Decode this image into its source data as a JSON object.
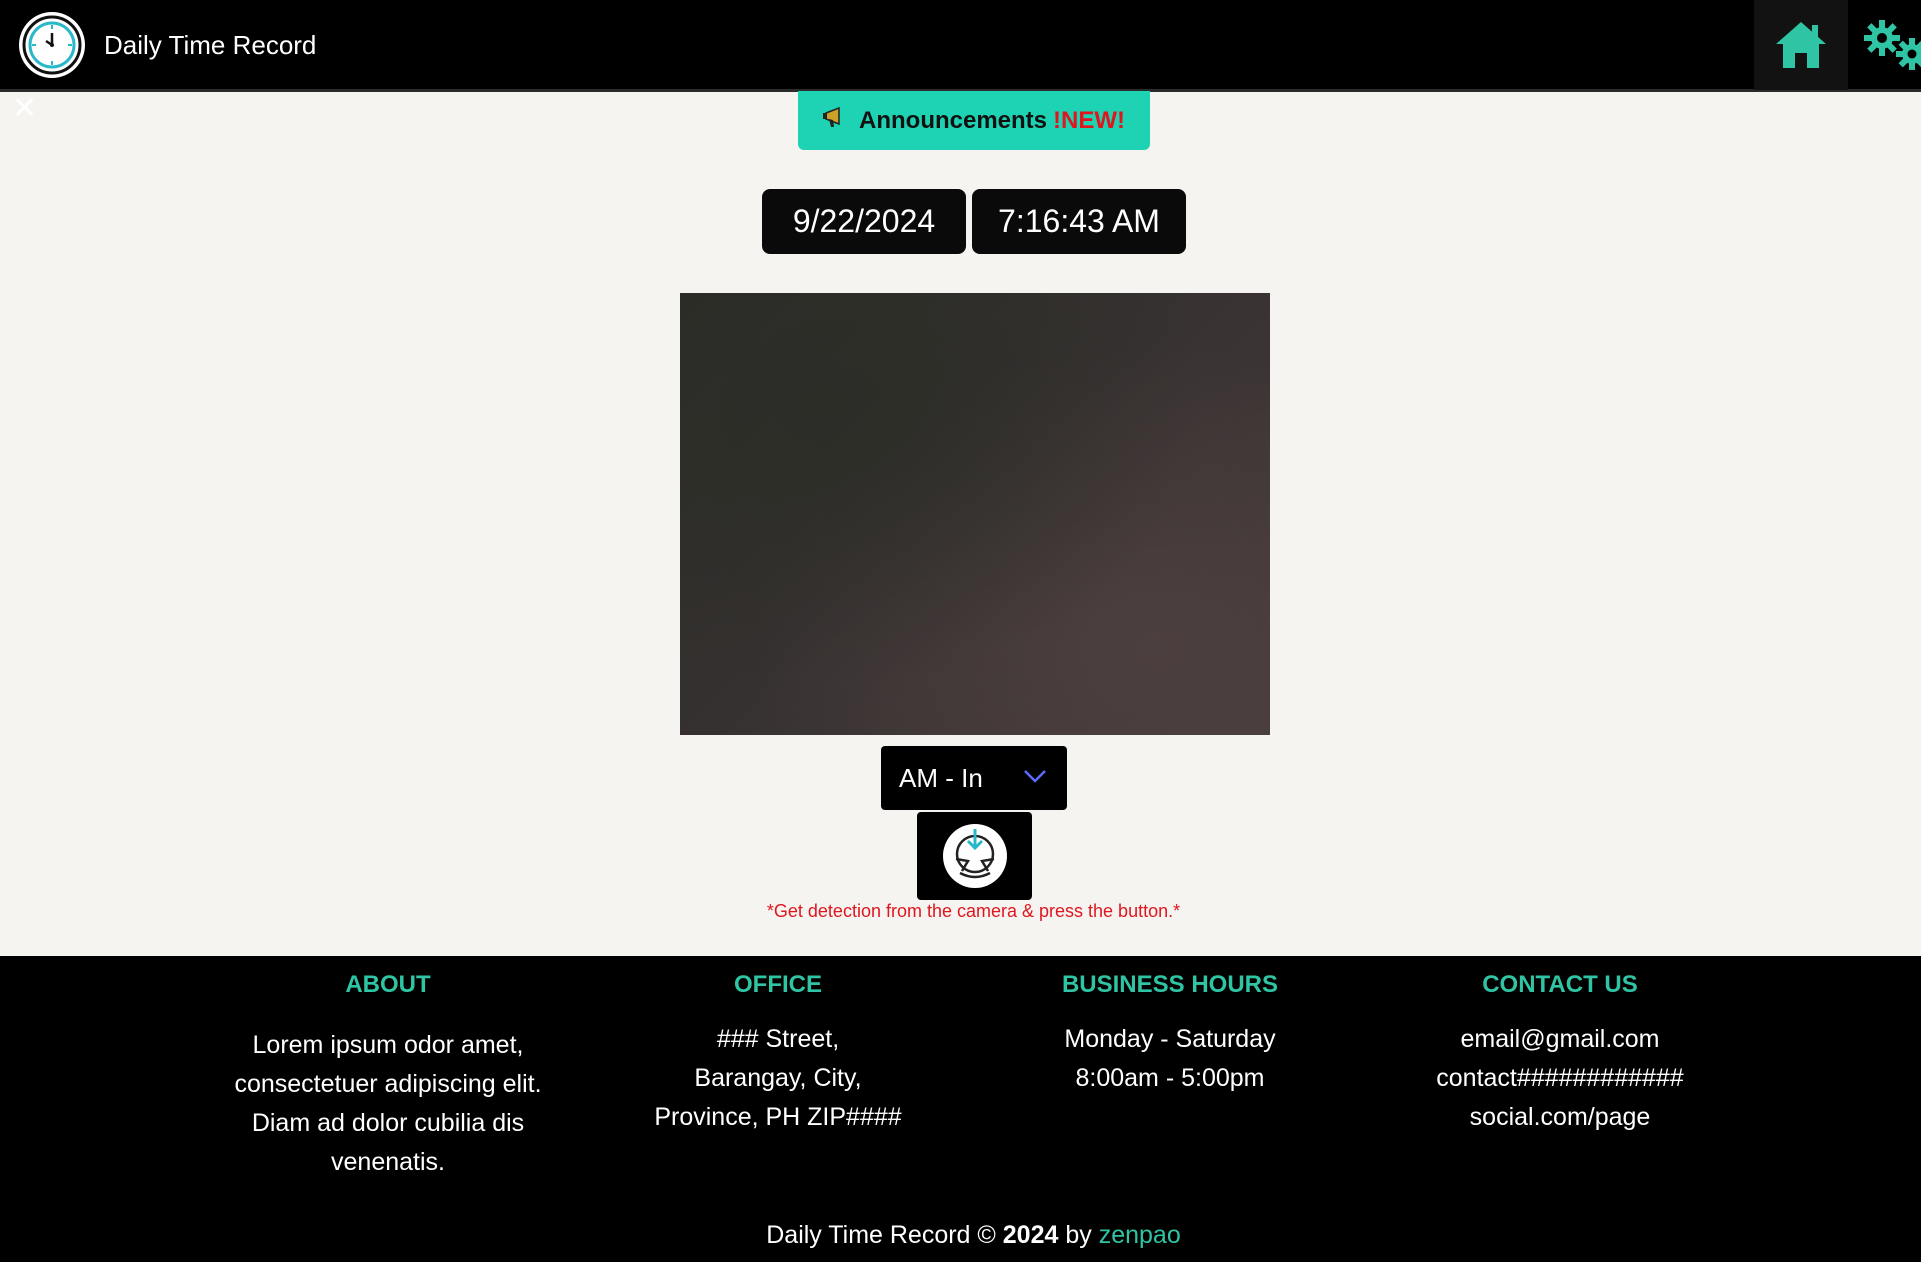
{
  "header": {
    "title": "Daily Time Record",
    "logo_icon": "clock-icon",
    "home_icon": "home-icon",
    "settings_icon": "gears-icon"
  },
  "close_icon": "close-icon",
  "announcement": {
    "icon": "megaphone-icon",
    "label": "Announcements",
    "badge": "!NEW!"
  },
  "datetime": {
    "date": "9/22/2024",
    "time": "7:16:43 AM"
  },
  "log_type": {
    "selected": "AM - In"
  },
  "capture_icon": "capture-icon",
  "hint": "*Get detection from the camera & press the button.*",
  "footer": {
    "about": {
      "heading": "ABOUT",
      "lines": [
        "Lorem ipsum odor amet,",
        "consectetuer adipiscing elit.",
        "Diam ad dolor cubilia dis",
        "venenatis."
      ]
    },
    "office": {
      "heading": "OFFICE",
      "lines": [
        "### Street,",
        "Barangay, City,",
        "Province, PH ZIP####"
      ]
    },
    "hours": {
      "heading": "BUSINESS HOURS",
      "lines": [
        "Monday - Saturday",
        "8:00am - 5:00pm"
      ]
    },
    "contact": {
      "heading": "CONTACT US",
      "lines": [
        "email@gmail.com",
        "contact############",
        "social.com/page"
      ]
    },
    "copyright": {
      "prefix": "Daily Time Record ©",
      "year": "2024",
      "by": "by",
      "author": "zenpao"
    }
  },
  "colors": {
    "accent": "#1dd3b3",
    "footer_heading": "#2ec4a4",
    "alert": "#e0161f",
    "dark": "#000000",
    "page_bg": "#f5f4f1"
  }
}
